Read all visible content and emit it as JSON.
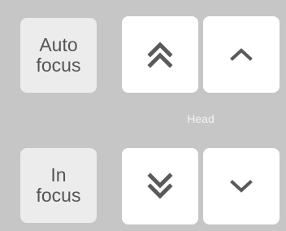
{
  "focus": {
    "auto_label": "Auto\nfocus",
    "in_label": "In\nfocus"
  },
  "head": {
    "label": "Head"
  },
  "icons": {
    "fast_up": "double-chevron-up-icon",
    "up": "chevron-up-icon",
    "fast_down": "double-chevron-down-icon",
    "down": "chevron-down-icon"
  },
  "colors": {
    "background": "#c6c6c6",
    "focus_button": "#ececec",
    "arrow_button": "#ffffff",
    "icon": "#5a5a5a",
    "label_text": "#555555",
    "head_label": "#f3f3f3"
  }
}
